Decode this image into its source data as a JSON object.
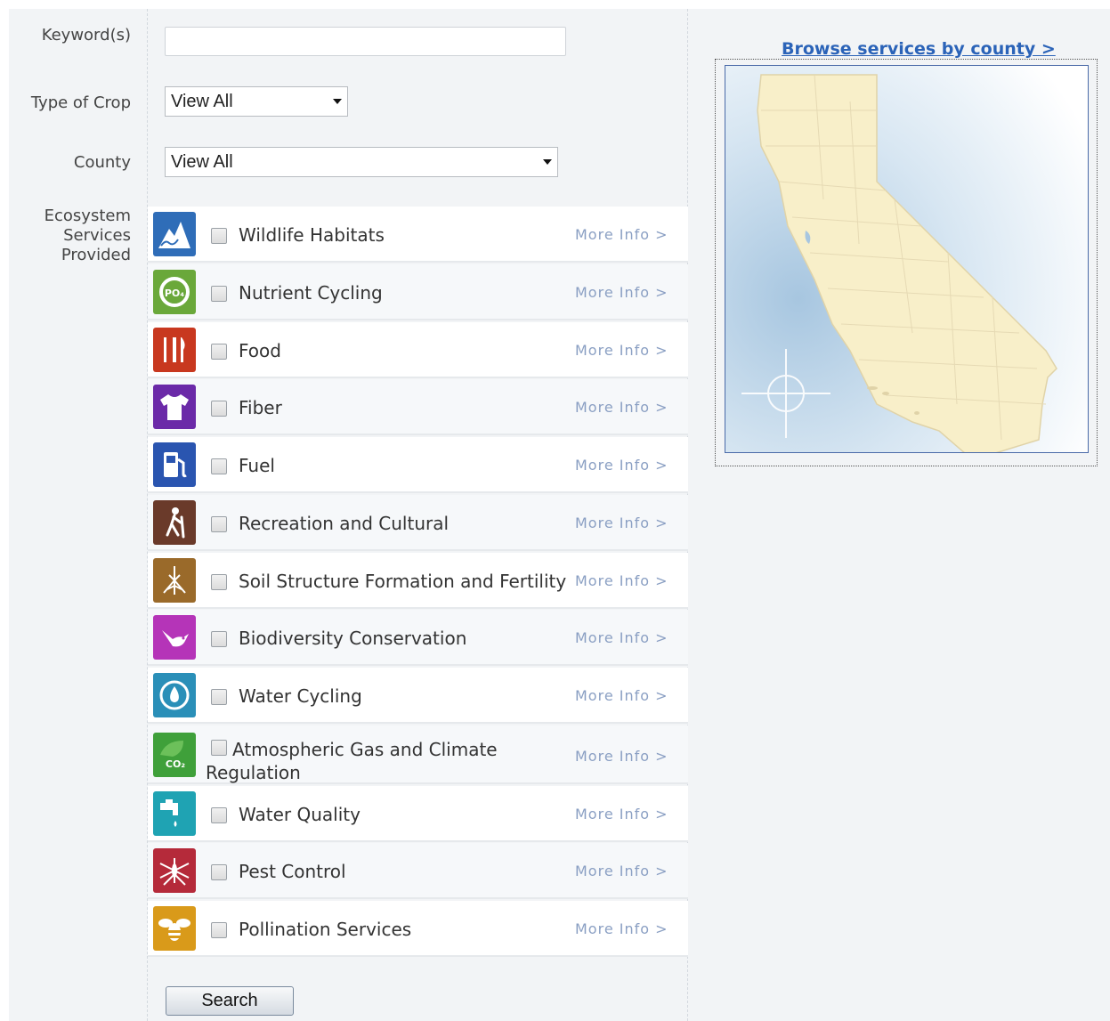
{
  "form": {
    "keyword_label": "Keyword(s)",
    "keyword_value": "",
    "crop_label": "Type of Crop",
    "crop_value": "View All",
    "county_label": "County",
    "county_value": "View All",
    "ecosystem_label_line1": "Ecosystem",
    "ecosystem_label_line2": "Services",
    "ecosystem_label_line3": "Provided",
    "search_label": "Search"
  },
  "services": [
    {
      "label": "Wildlife Habitats",
      "more": "More Info >",
      "icon": "mountains-icon",
      "color": "#2f6db8"
    },
    {
      "label": "Nutrient Cycling",
      "more": "More Info >",
      "icon": "phosphate-cycle-icon",
      "color": "#6aa83a"
    },
    {
      "label": "Food",
      "more": "More Info >",
      "icon": "fork-knife-icon",
      "color": "#c8381f"
    },
    {
      "label": "Fiber",
      "more": "More Info >",
      "icon": "tshirt-icon",
      "color": "#6b2aa8"
    },
    {
      "label": "Fuel",
      "more": "More Info >",
      "icon": "fuel-pump-icon",
      "color": "#2a55b0"
    },
    {
      "label": "Recreation and Cultural",
      "more": "More Info >",
      "icon": "hiker-icon",
      "color": "#6a3a2a"
    },
    {
      "label": "Soil Structure Formation and Fertility",
      "more": "More Info >",
      "icon": "roots-icon",
      "color": "#9a6a2a"
    },
    {
      "label": "Biodiversity Conservation",
      "more": "More Info >",
      "icon": "bird-icon",
      "color": "#b534b8"
    },
    {
      "label": "Water Cycling",
      "more": "More Info >",
      "icon": "water-drop-cycle-icon",
      "color": "#2a8fb8"
    },
    {
      "label": "Atmospheric Gas and Climate Regulation",
      "more": "More Info >",
      "icon": "co2-leaf-icon",
      "color": "#3fa03a"
    },
    {
      "label": "Water Quality",
      "more": "More Info >",
      "icon": "faucet-icon",
      "color": "#1fa3b3"
    },
    {
      "label": "Pest Control",
      "more": "More Info >",
      "icon": "mosquito-icon",
      "color": "#b52a3a"
    },
    {
      "label": "Pollination Services",
      "more": "More Info >",
      "icon": "bee-icon",
      "color": "#d99a1a"
    }
  ],
  "map": {
    "browse_link": "Browse services by county >"
  }
}
